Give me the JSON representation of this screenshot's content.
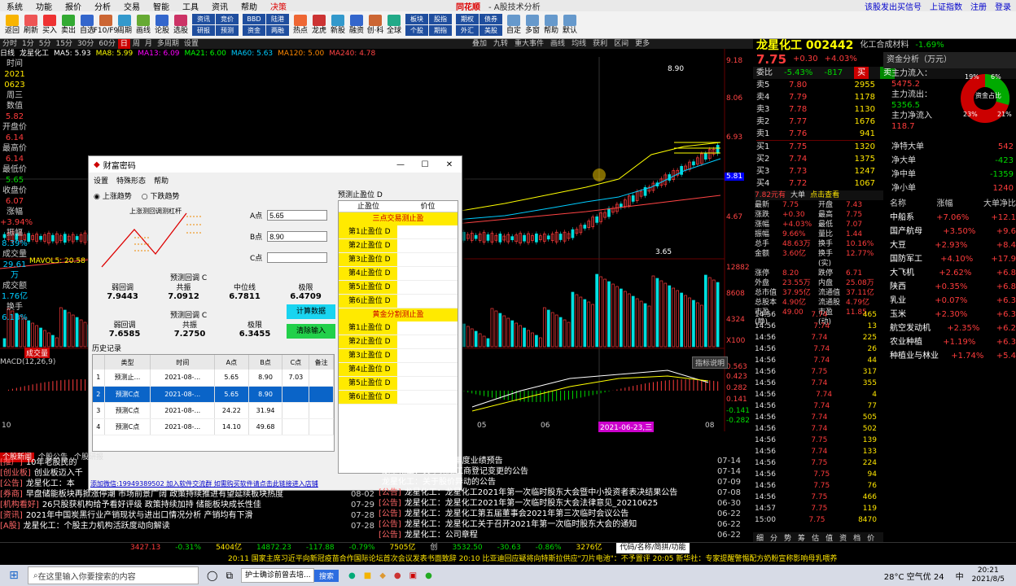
{
  "menubar": {
    "items": [
      "系统",
      "功能",
      "报价",
      "分析",
      "交易",
      "智能",
      "工具",
      "资讯",
      "帮助",
      "决策"
    ],
    "logo": "同花顺",
    "title": "- A股技术分析",
    "right": [
      "该股发出买信号",
      "上证指数",
      "注册",
      "登录"
    ]
  },
  "toolbar": {
    "buttons": [
      "返回",
      "刷新",
      "买入",
      "卖出",
      "自选",
      "F10/F9",
      "周期",
      "画线",
      "论股",
      "选股"
    ],
    "grid1": [
      "资讯",
      "竞价",
      "研报",
      "预测"
    ],
    "grid2": [
      "BBD",
      "陆港",
      "资金",
      "两融"
    ],
    "buttons2": [
      "热点",
      "龙虎",
      "新股",
      "融资",
      "创·科",
      "全球"
    ],
    "grid3": [
      "板块",
      "股指",
      "个股",
      "期指"
    ],
    "grid4": [
      "期权",
      "债券",
      "外汇",
      "美股"
    ],
    "buttons3": [
      "自定",
      "多窗",
      "帮助",
      "默认"
    ]
  },
  "tabbar": {
    "tabs": [
      "分时",
      "1分",
      "5分",
      "15分",
      "30分",
      "60分",
      "日",
      "周",
      "月",
      "多周期",
      "设置"
    ],
    "active": "日"
  },
  "chart": {
    "title": "日线",
    "name": "龙星化工",
    "ma": [
      "MA5: 5.93",
      "MA8: 5.99",
      "MA13: 6.09",
      "MA21: 6.00",
      "MA60: 5.63",
      "MA120: 5.00",
      "MA240: 4.78"
    ],
    "right_menu": [
      "叠加",
      "九转",
      "重大事件",
      "画线",
      "均线",
      "获利",
      "区间",
      "更多"
    ],
    "axis": [
      "9.18",
      "8.06",
      "6.93",
      "5.81",
      "4.67"
    ],
    "high": "8.90",
    "low": "3.65",
    "vol_axis": [
      "12882",
      "8608",
      "4324",
      "X100"
    ],
    "macd": "MACD(12,26,9)",
    "macd_axis": [
      "0.563",
      "0.423",
      "0.282",
      "0.141",
      "-0.141",
      "-0.282"
    ],
    "dates": [
      "10",
      "05",
      "06",
      "07",
      "08"
    ],
    "cursor_date": "2021-06-23,三",
    "sub": "成交量",
    "volname": "MAVOL5: 20.58",
    "btn": "指标说明"
  },
  "leftpanel": {
    "rows": [
      {
        "k": "时间",
        "v": "2021"
      },
      {
        "k": "",
        "v": "0623"
      },
      {
        "k": "周三",
        "v": ""
      },
      {
        "k": "数值",
        "v": "5.82"
      },
      {
        "k": "开盘价",
        "v": "6.14"
      },
      {
        "k": "最高价",
        "v": "6.14"
      },
      {
        "k": "最低价",
        "v": "5.65"
      },
      {
        "k": "收盘价",
        "v": "6.07"
      },
      {
        "k": "涨幅",
        "v": "+3.94%"
      },
      {
        "k": "振幅",
        "v": "8.39%"
      },
      {
        "k": "成交量",
        "v": "29.61万"
      },
      {
        "k": "成交额",
        "v": "1.76亿"
      },
      {
        "k": "换手",
        "v": "6.18%"
      }
    ]
  },
  "dialog": {
    "title": "财富密码",
    "menu": [
      "设置",
      "特殊形态",
      "帮助"
    ],
    "radio": [
      "上涨趋势",
      "下跌趋势"
    ],
    "diagram": "上涨测回调测杠杆",
    "fields": [
      {
        "label": "A点",
        "value": "5.65"
      },
      {
        "label": "B点",
        "value": "8.90"
      },
      {
        "label": "C点",
        "value": ""
      }
    ],
    "pred_label": "预测回调 C",
    "pred_cols": [
      "弱回调",
      "共振",
      "中位线",
      "极限"
    ],
    "pred_vals": [
      "7.9443",
      "7.0912",
      "6.7811",
      "6.4709"
    ],
    "pred2_cols": [
      "弱回调",
      "共振",
      "极限"
    ],
    "pred2_vals": [
      "7.6585",
      "7.2750",
      "6.3455"
    ],
    "calc_btn": "计算数据",
    "clear_btn": "清除输入",
    "history": "历史记录",
    "hist_cols": [
      "类型",
      "时间",
      "A点",
      "B点",
      "C点",
      "备注"
    ],
    "hist_rows": [
      [
        "1",
        "预测止...",
        "2021-08-...",
        "5.65",
        "8.90",
        "7.03",
        ""
      ],
      [
        "2",
        "预测C点",
        "2021-08-...",
        "5.65",
        "8.90",
        "",
        ""
      ],
      [
        "3",
        "预测C点",
        "2021-08-...",
        "24.22",
        "31.94",
        "",
        ""
      ],
      [
        "4",
        "预测C点",
        "2021-08-...",
        "14.10",
        "49.68",
        "",
        ""
      ]
    ],
    "stop_title": "预测止盈位 D",
    "stop_cols": [
      "止盈位",
      "价位"
    ],
    "sec1": "三点交易测止盈",
    "sec2": "黄金分割测止盈",
    "stop_rows": [
      "第1止盈位 D",
      "第2止盈位 D",
      "第3止盈位 D",
      "第4止盈位 D",
      "第5止盈位 D",
      "第6止盈位 D"
    ],
    "footer": "添加微信:19949389502 加入软件交流群 如需购买软件请点击此链接进入店铺"
  },
  "right": {
    "name": "龙星化工 002442",
    "industry": "化工合成材料",
    "ind_pct": "-1.69%",
    "price": "7.75",
    "chg": "+0.30",
    "pct": "+4.03%",
    "weibi": "委比",
    "wb_pct": "-5.43%",
    "wb_num": "-817",
    "sell": [
      [
        "5",
        "7.80",
        "2955"
      ],
      [
        "4",
        "7.79",
        "1178"
      ],
      [
        "3",
        "7.78",
        "1130"
      ],
      [
        "2",
        "7.77",
        "1676"
      ],
      [
        "1",
        "7.76",
        "941"
      ]
    ],
    "buy": [
      [
        "1",
        "7.75",
        "1320"
      ],
      [
        "2",
        "7.74",
        "1375"
      ],
      [
        "3",
        "7.73",
        "1247"
      ],
      [
        "4",
        "7.72",
        "1067"
      ],
      [
        "5",
        "7.71",
        "1238"
      ]
    ],
    "fund_title": "资金分析（万元）",
    "fund": [
      {
        "k": "主力流入：",
        "v": "5475.2"
      },
      {
        "k": "主力流出：",
        "v": "5356.5"
      },
      {
        "k": "主力净流入",
        "v": "118.7"
      }
    ],
    "pie": [
      "19%",
      "6%",
      "21%",
      "23%",
      "资金占比"
    ],
    "net": [
      {
        "k": "净特大单",
        "v": "542"
      },
      {
        "k": "净大单",
        "v": "-423"
      },
      {
        "k": "净中单",
        "v": "-1359"
      },
      {
        "k": "净小单",
        "v": "1240"
      }
    ],
    "stats": [
      [
        "最新",
        "7.75",
        "开盘",
        "7.43"
      ],
      [
        "涨跌",
        "+0.30",
        "最高",
        "7.75"
      ],
      [
        "涨幅",
        "+4.03%",
        "最低",
        "7.07"
      ],
      [
        "振幅",
        "9.66%",
        "量比",
        "1.44"
      ],
      [
        "总手",
        "48.63万",
        "换手",
        "10.16%"
      ],
      [
        "金额",
        "3.60亿",
        "换手(实)",
        "12.77%"
      ],
      [
        "涨停",
        "8.20",
        "跌停",
        "6.71"
      ],
      [
        "外盘",
        "23.55万",
        "内盘",
        "25.08万"
      ],
      [
        "总市值",
        "37.95亿",
        "流通值",
        "37.11亿"
      ],
      [
        "总股本",
        "4.90亿",
        "流通股",
        "4.79亿"
      ],
      [
        "市盈(静)",
        "49.00",
        "市盈(动)",
        "11.85"
      ]
    ],
    "stats_head": [
      "7.82元有",
      "大单",
      "点击查看"
    ],
    "sector_head": [
      "名称",
      "涨幅",
      "大单净比"
    ],
    "sectors": [
      [
        "中船系",
        "+7.06%",
        "+12.1"
      ],
      [
        "国产航母",
        "+3.50%",
        "+9.6"
      ],
      [
        "大豆",
        "+2.93%",
        "+8.4"
      ],
      [
        "国防军工",
        "+4.10%",
        "+17.9"
      ],
      [
        "大飞机",
        "+2.62%",
        "+6.8"
      ],
      [
        "陕西",
        "+0.35%",
        "+6.8"
      ],
      [
        "乳业",
        "+0.07%",
        "+6.3"
      ],
      [
        "玉米",
        "+2.30%",
        "+6.3"
      ],
      [
        "航空发动机",
        "+2.35%",
        "+6.2"
      ],
      [
        "农业种植",
        "+1.19%",
        "+6.3"
      ],
      [
        "种植业与林业",
        "+1.74%",
        "+5.4"
      ]
    ],
    "ticks": [
      [
        "14:56",
        "7.74",
        "465"
      ],
      [
        "14:56",
        "7.74",
        "13"
      ],
      [
        "14:56",
        "7.74",
        "225"
      ],
      [
        "14:56",
        "7.74",
        "26"
      ],
      [
        "14:56",
        "7.74",
        "44"
      ],
      [
        "14:56",
        "7.75",
        "317"
      ],
      [
        "14:56",
        "7.74",
        "355"
      ],
      [
        "14:56",
        "7.74",
        "4"
      ],
      [
        "14:56",
        "7.74",
        "77"
      ],
      [
        "14:56",
        "7.74",
        "505"
      ],
      [
        "14:56",
        "7.74",
        "502"
      ],
      [
        "14:56",
        "7.75",
        "139"
      ],
      [
        "14:56",
        "7.74",
        "133"
      ],
      [
        "14:56",
        "7.75",
        "224"
      ],
      [
        "14:56",
        "7.75",
        "94"
      ],
      [
        "14:56",
        "7.75",
        "76"
      ],
      [
        "14:56",
        "7.75",
        "466"
      ],
      [
        "14:57",
        "7.75",
        "119"
      ],
      [
        "15:00",
        "7.75",
        "8470"
      ]
    ],
    "bottom_tabs": [
      "细",
      "分",
      "势",
      "筹",
      "估",
      "值",
      "资",
      "档",
      "价"
    ]
  },
  "news": {
    "left": [
      [
        "推广",
        "10年老股民的"
      ],
      [
        "创业板",
        "创业板迈入千"
      ],
      [
        "公告",
        "龙星化工：本"
      ],
      [
        "券商",
        "早盘储能板块再掀涨停潮 市场前景广阔 政策持续推进有望延续板块热度"
      ],
      [
        "机构看好",
        "26只股获机构给予看好评级 政策持续加持 储能板块成长性佳"
      ],
      [
        "资讯",
        "2021年中国炭黑行业产销现状与进出口情况分析 产销均有下滑"
      ],
      [
        "A股",
        "龙星化工：个股主力机构活跃度动向解读"
      ]
    ],
    "left_dates": [
      "08-02",
      "07-29",
      "07-28",
      "07-28"
    ],
    "tabs": [
      "个股新闻",
      "个股公告",
      "个股研报"
    ],
    "right": [
      [
        "",
        "龙星化工 2021年半年度业绩预告",
        "07-14"
      ],
      [
        "",
        "龙星化工：关于完成工商登记变更的公告",
        "07-14"
      ],
      [
        "",
        "龙星化工：关于股价异动的公告",
        "07-09"
      ],
      [
        "公告",
        "龙星化工：龙星化工2021年第一次临时股东大会暨中小投资者表决结果公告",
        "07-08"
      ],
      [
        "公告",
        "龙星化工：龙星化工2021年第一次临时股东大会法律意见_20210625",
        "06-30"
      ],
      [
        "公告",
        "龙星化工：龙星化工第五届董事会2021年第三次临时会议公告",
        "06-22"
      ],
      [
        "公告",
        "龙星化工：龙星化工关于召开2021年第一次临时股东大会的通知",
        "06-22"
      ],
      [
        "公告",
        "龙星化工：公司章程",
        "06-22"
      ]
    ]
  },
  "status": {
    "r1": [
      "3427.13",
      "-0.31%",
      "5404亿",
      "14872.23",
      "-117.88",
      "-0.79%",
      "7505亿",
      "创",
      "3532.50",
      "-30.63",
      "-0.86%",
      "3276亿",
      "代码/名称/简拼/功能"
    ],
    "r2": "20:11 国家主席习近平向新冠疫苗合作国际论坛首次会议发表书面致辞   20:10 比亚迪回应疑将向特斯拉供应\"刀片电池\"：不予置评   20:05 新华社：专家提醒警惕配方奶粉宣称影响母乳喂养"
  },
  "taskbar": {
    "search": "在这里输入你要搜索的内容",
    "search2": "护士确诊前曾去培...",
    "search_btn": "搜索",
    "weather": "28°C 空气优 24",
    "ime": "中",
    "time": "20:21",
    "date": "2021/8/5"
  }
}
